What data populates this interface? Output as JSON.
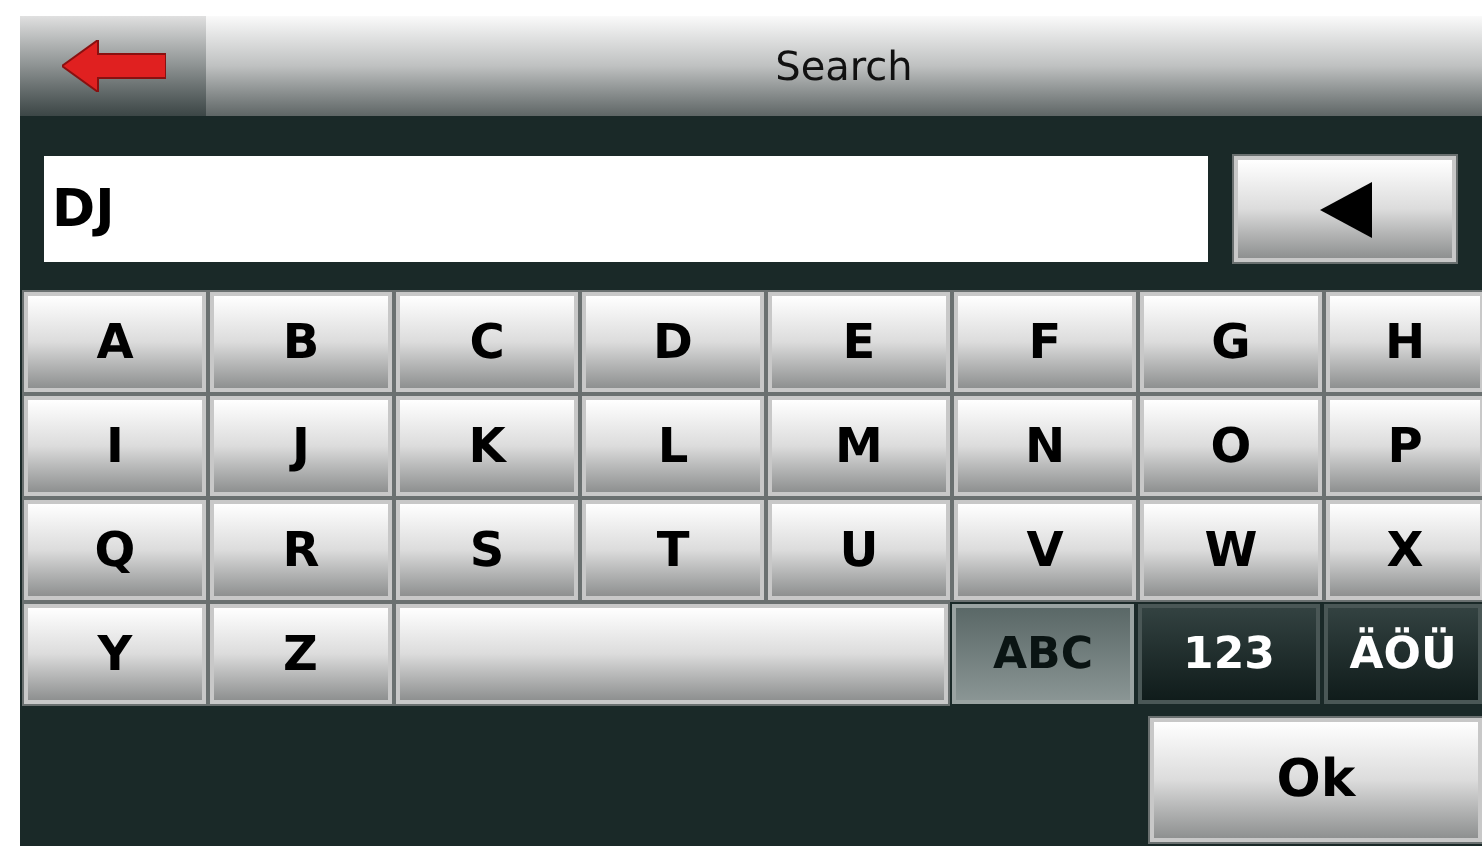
{
  "header": {
    "title": "Search"
  },
  "search_field": {
    "value": "DJ"
  },
  "keyboard": {
    "rows": [
      [
        "A",
        "B",
        "C",
        "D",
        "E",
        "F",
        "G",
        "H"
      ],
      [
        "I",
        "J",
        "K",
        "L",
        "M",
        "N",
        "O",
        "P"
      ],
      [
        "Q",
        "R",
        "S",
        "T",
        "U",
        "V",
        "W",
        "X"
      ]
    ],
    "bottom_letters": [
      "Y",
      "Z"
    ],
    "modes": [
      {
        "label": "ABC",
        "selected": true
      },
      {
        "label": "123",
        "selected": false
      },
      {
        "label": "ÄÖÜ",
        "selected": false
      }
    ]
  },
  "ok_button": {
    "label": "Ok"
  }
}
